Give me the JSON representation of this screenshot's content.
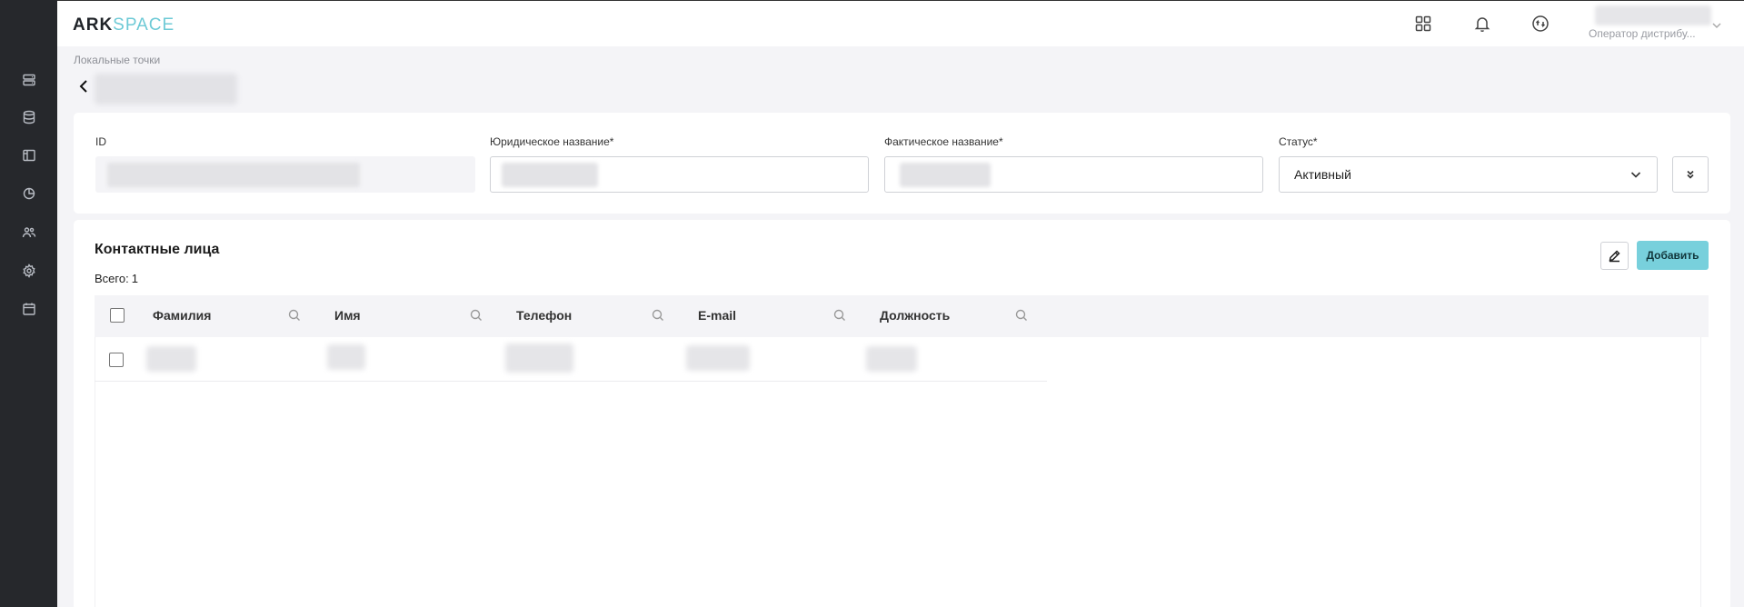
{
  "app": {
    "logo_part1": "ARK",
    "logo_part2": "SPACE"
  },
  "sidebar": {
    "items": [
      {
        "icon": "server-icon"
      },
      {
        "icon": "database-icon"
      },
      {
        "icon": "layout-icon"
      },
      {
        "icon": "pie-chart-icon"
      },
      {
        "icon": "users-icon"
      },
      {
        "icon": "gear-icon"
      },
      {
        "icon": "calendar-icon"
      }
    ]
  },
  "header": {
    "icons": [
      "apps-grid-icon",
      "bell-icon",
      "sync-icon"
    ],
    "user_role": "Оператор дистрибу..."
  },
  "breadcrumb": "Локальные точки",
  "form": {
    "id_label": "ID",
    "legal_name_label": "Юридическое название*",
    "actual_name_label": "Фактическое название*",
    "status_label": "Статус*",
    "status_value": "Активный"
  },
  "contacts": {
    "title": "Контактные лица",
    "total_label": "Всего:",
    "total_value": "1",
    "add_label": "Добавить",
    "columns": [
      "Фамилия",
      "Имя",
      "Телефон",
      "E-mail",
      "Должность"
    ]
  },
  "colors": {
    "sidebar_bg": "#26282c",
    "accent": "#78d0dc",
    "logo_accent": "#6ecad6",
    "page_bg": "#f4f4f7"
  }
}
